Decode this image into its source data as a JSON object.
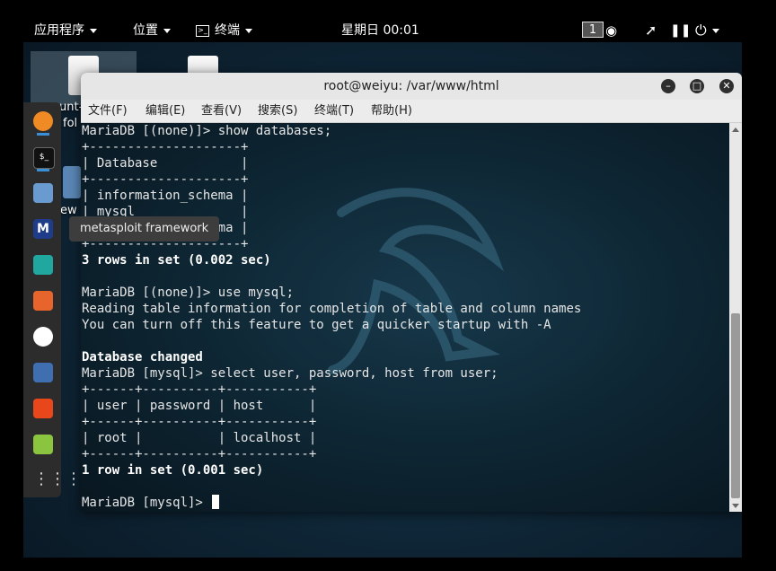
{
  "top_panel": {
    "apps_menu": "应用程序",
    "places_menu": "位置",
    "terminal_menu": "终端",
    "clock": "星期日 00:01",
    "workspace": "1"
  },
  "desktop": {
    "icon1_label_a": "unt-",
    "icon1_label_b": "fol",
    "icon2_label": "ew"
  },
  "dock": {
    "tooltip": "metasploit framework",
    "icons": [
      "firefox-icon",
      "terminal-icon",
      "files-icon",
      "metasploit-icon",
      "armitage-icon",
      "burpsuite-icon",
      "maltego-icon",
      "beef-icon",
      "faraday-icon",
      "leafpad-icon",
      "app-grid-icon"
    ]
  },
  "window": {
    "title": "root@weiyu: /var/www/html",
    "menu": [
      "文件(F)",
      "编辑(E)",
      "查看(V)",
      "搜索(S)",
      "终端(T)",
      "帮助(H)"
    ]
  },
  "terminal": {
    "lines": [
      "MariaDB [(none)]> show databases;",
      "+--------------------+",
      "| Database           |",
      "+--------------------+",
      "| information_schema |",
      "| mysql              |",
      "| performance_schema |",
      "+--------------------+",
      "3 rows in set (0.002 sec)",
      "",
      "MariaDB [(none)]> use mysql;",
      "Reading table information for completion of table and column names",
      "You can turn off this feature to get a quicker startup with -A",
      "",
      "Database changed",
      "MariaDB [mysql]> select user, password, host from user;",
      "+------+----------+-----------+",
      "| user | password | host      |",
      "+------+----------+-----------+",
      "| root |          | localhost |",
      "+------+----------+-----------+",
      "1 row in set (0.001 sec)",
      ""
    ],
    "prompt": "MariaDB [mysql]> "
  }
}
